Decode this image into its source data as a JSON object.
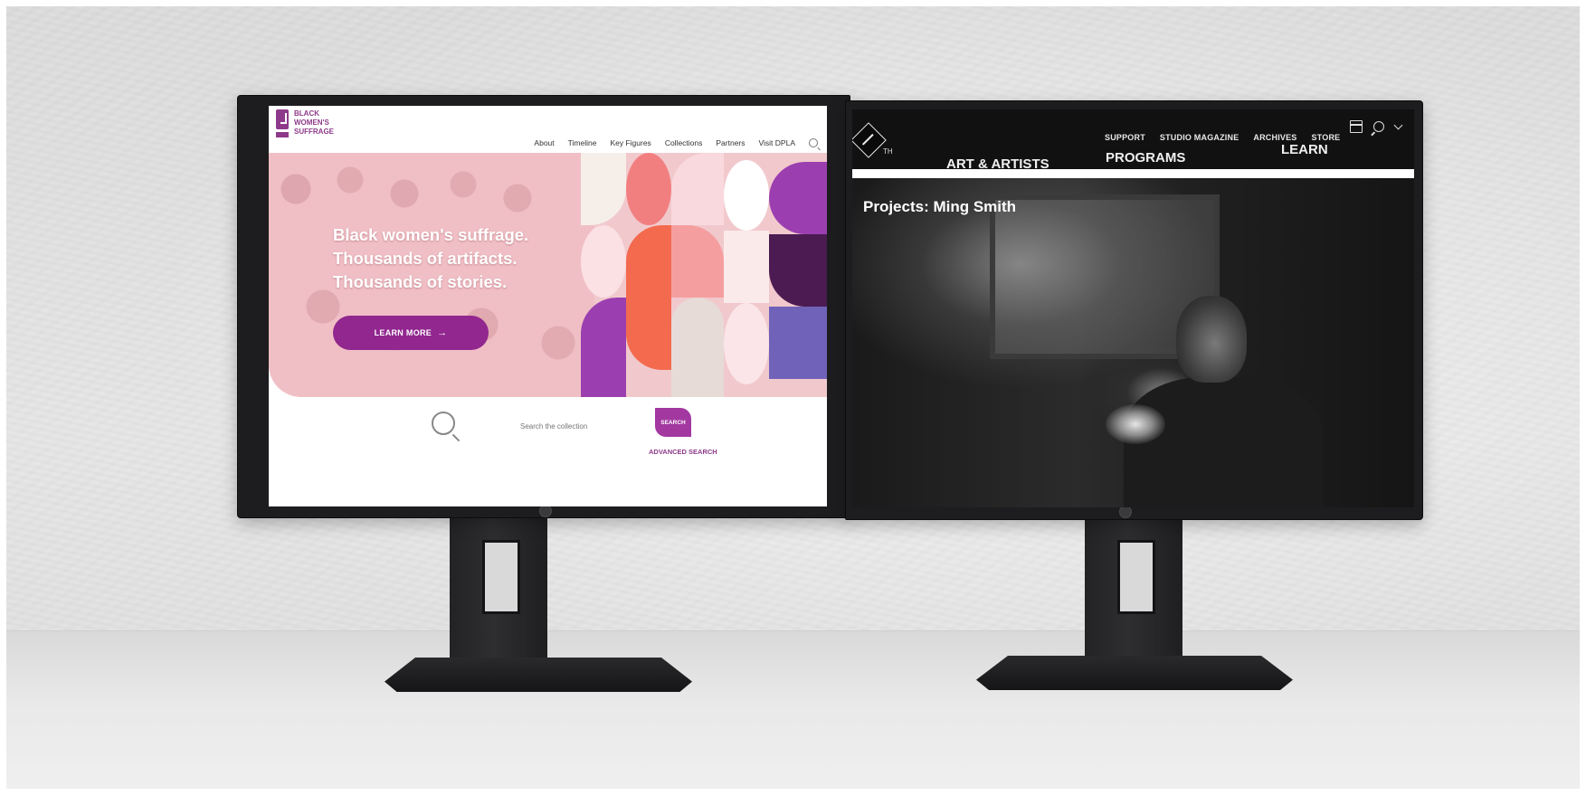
{
  "left_screen": {
    "logo_lines": [
      "BLACK",
      "WOMEN'S",
      "SUFFRAGE"
    ],
    "nav": [
      "About",
      "Timeline",
      "Key Figures",
      "Collections",
      "Partners",
      "Visit DPLA"
    ],
    "hero": {
      "lines": [
        "Black women's suffrage.",
        "Thousands of artifacts.",
        "Thousands of stories."
      ],
      "button_label": "LEARN MORE",
      "button_arrow": "→"
    },
    "search": {
      "placeholder": "Search the collection",
      "button_label": "SEARCH",
      "advanced_link": "ADVANCED SEARCH"
    },
    "colors": {
      "brand": "#91278f",
      "hero_bg": "#f1c9cd"
    }
  },
  "right_screen": {
    "logo_suffix": "TH",
    "top_nav": [
      "SUPPORT",
      "STUDIO MAGAZINE",
      "ARCHIVES",
      "STORE"
    ],
    "main_nav": [
      "ART & ARTISTS",
      "PROGRAMS",
      "LEARN"
    ],
    "icons": [
      "calendar-icon",
      "search-icon",
      "chevron-down-icon"
    ],
    "video_title": "Projects: Ming Smith"
  }
}
